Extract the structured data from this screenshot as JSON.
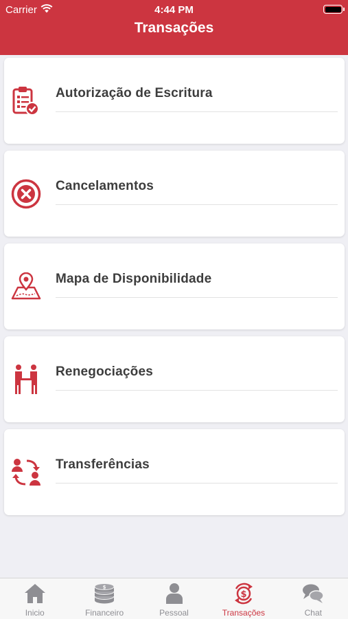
{
  "status_bar": {
    "carrier": "Carrier",
    "time": "4:44 PM"
  },
  "header": {
    "title": "Transações"
  },
  "items": [
    {
      "label": "Autorização de Escritura",
      "icon": "clipboard-check-icon"
    },
    {
      "label": "Cancelamentos",
      "icon": "cancel-circle-icon"
    },
    {
      "label": "Mapa de Disponibilidade",
      "icon": "map-pin-icon"
    },
    {
      "label": "Renegociações",
      "icon": "handshake-icon"
    },
    {
      "label": "Transferências",
      "icon": "transfer-users-icon"
    }
  ],
  "tabs": [
    {
      "label": "Inicio",
      "icon": "home-icon",
      "active": false
    },
    {
      "label": "Financeiro",
      "icon": "coins-icon",
      "active": false
    },
    {
      "label": "Pessoal",
      "icon": "user-icon",
      "active": false
    },
    {
      "label": "Transações",
      "icon": "money-exchange-icon",
      "active": true
    },
    {
      "label": "Chat",
      "icon": "chat-icon",
      "active": false
    }
  ],
  "colors": {
    "primary": "#cc3540",
    "background": "#efeff4",
    "text": "#3d3d3d",
    "tab_inactive": "#8e8e93"
  }
}
